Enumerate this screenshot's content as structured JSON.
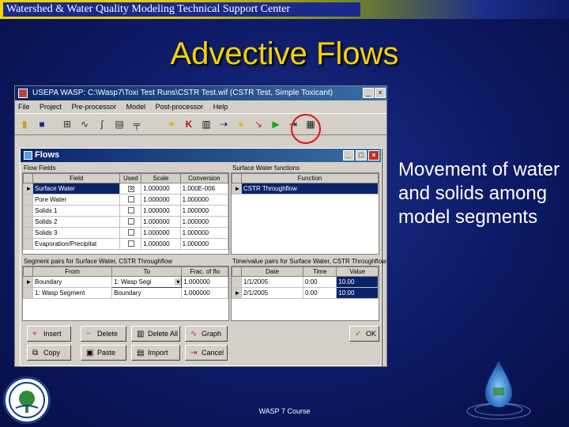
{
  "header": {
    "org_title": "Watershed & Water Quality Modeling Technical Support Center"
  },
  "slide": {
    "title": "Advective Flows",
    "bullet": "Movement of water and solids among model segments",
    "footer": "WASP 7 Course"
  },
  "app": {
    "title": "USEPA WASP: C:\\Wasp7\\Toxi Test Runs\\CSTR Test.wif (CSTR Test, Simple Toxicant)",
    "menu": [
      "File",
      "Project",
      "Pre-processor",
      "Model",
      "Post-processor",
      "Help"
    ],
    "toolbar_icons": [
      "open-icon",
      "save-icon",
      "graph-icon",
      "chart-icon",
      "function-icon",
      "table-icon",
      "plot-icon",
      "kinetics-icon",
      "k-icon",
      "boundary-icon",
      "pointer-icon",
      "flows-icon",
      "run-icon",
      "exit-icon",
      "grid-icon"
    ]
  },
  "flows_dialog": {
    "title": "Flows",
    "flow_fields": {
      "label": "Flow Fields",
      "columns": [
        "Field",
        "Used",
        "Scale",
        "Conversion"
      ],
      "rows": [
        {
          "field": "Surface Water",
          "used": true,
          "scale": "1.000000",
          "conversion": "1.000E-006"
        },
        {
          "field": "Pore Water",
          "used": false,
          "scale": "1.000000",
          "conversion": "1.000000"
        },
        {
          "field": "Solids 1",
          "used": false,
          "scale": "1.000000",
          "conversion": "1.000000"
        },
        {
          "field": "Solids 2",
          "used": false,
          "scale": "1.000000",
          "conversion": "1.000000"
        },
        {
          "field": "Solids 3",
          "used": false,
          "scale": "1.000000",
          "conversion": "1.000000"
        },
        {
          "field": "Evaporation/Precipitat",
          "used": false,
          "scale": "1.000000",
          "conversion": "1.000000"
        }
      ]
    },
    "functions": {
      "label": "Surface Water functions",
      "columns": [
        "Function"
      ],
      "rows": [
        {
          "function": "CSTR Throughflow"
        }
      ]
    },
    "segment_pairs": {
      "label": "Segment pairs for Surface Water, CSTR Throughflow",
      "columns": [
        "From",
        "To",
        "Frac. of flo"
      ],
      "rows": [
        {
          "from": "Boundary",
          "to": "1: Wasp Segi",
          "frac": "1.000000"
        },
        {
          "from": "1: Wasp Segment",
          "to": "Boundary",
          "frac": "1.000000"
        }
      ]
    },
    "time_pairs": {
      "label": "Time/value pairs for Surface Water, CSTR Throughflow",
      "columns": [
        "Date",
        "Time",
        "Value"
      ],
      "rows": [
        {
          "date": "1/1/2005",
          "time": "0:00",
          "value": "10.00"
        },
        {
          "date": "2/1/2005",
          "time": "0:00",
          "value": "10.00"
        }
      ]
    },
    "buttons": {
      "insert": "Insert",
      "delete": "Delete",
      "delete_all": "Delete All",
      "graph": "Graph",
      "copy": "Copy",
      "paste": "Paste",
      "import": "Import",
      "ok": "OK",
      "cancel": "Cancel"
    }
  },
  "colors": {
    "title_yellow": "#f5d200",
    "background_blue": "#0d1a66",
    "highlight_red": "#e01010"
  }
}
